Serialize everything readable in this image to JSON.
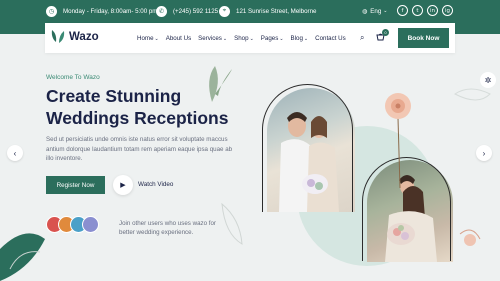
{
  "topbar": {
    "hours": "Monday - Friday, 8:00am- 5:00 pm",
    "phone": "(+245) 592 1125",
    "address": "121 Sunrise Street, Melborne",
    "language": "Eng",
    "social": [
      "f",
      "t",
      "in",
      "ig"
    ]
  },
  "nav": {
    "logo": "Wazo",
    "items": [
      {
        "label": "Home",
        "dropdown": true
      },
      {
        "label": "About Us",
        "dropdown": false
      },
      {
        "label": "Services",
        "dropdown": true
      },
      {
        "label": "Shop",
        "dropdown": true
      },
      {
        "label": "Pages",
        "dropdown": true
      },
      {
        "label": "Blog",
        "dropdown": true
      },
      {
        "label": "Contact Us",
        "dropdown": false
      }
    ],
    "cart_count": "0",
    "book_label": "Book Now"
  },
  "hero": {
    "welcome": "Welcome To Wazo",
    "title_line1": "Create Stunning",
    "title_line2": "Weddings Receptions",
    "description": "Sed ut persiciatis unde omnis iste natus error sit voluptate maccus antium dolorque laudantium totam rem aperiam eaque ipsa quae ab illo inventore.",
    "register_label": "Register Now",
    "watch_label": "Watch Video",
    "join_text": "Join other users who uses wazo for better wedding experience."
  },
  "colors": {
    "brand": "#2b6e5c",
    "heading": "#1b2347",
    "hero_bg": "#eef1f1"
  },
  "icons": [
    "clock-icon",
    "phone-icon",
    "location-icon",
    "globe-icon",
    "search-icon",
    "cart-icon",
    "play-icon",
    "arrow-left-icon",
    "arrow-right-icon",
    "gear-icon"
  ]
}
